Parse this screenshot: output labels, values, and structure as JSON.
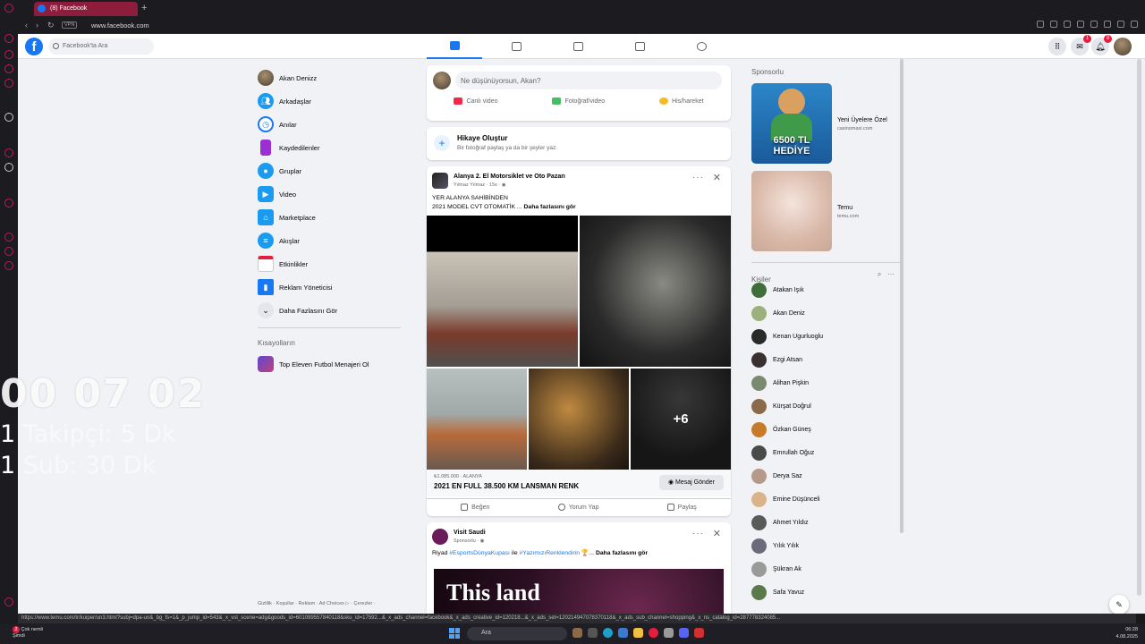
{
  "browser": {
    "tab_title": "(8) Facebook",
    "url": "www.facebook.com",
    "vpn_label": "VPN",
    "status_url": "https://www.temu.com/tr/kuiper/un3.html?subj=dpa-un&_bg_fs=1&_p_jump_id=543&_x_vst_scene=adg&goods_id=601099557840118&sku_id=17592...&_x_ads_channel=facebook&_x_ads_creative_id=120218...&_x_ads_set=120214947078370118&_x_ads_sub_channel=shopping&_x_ns_catalog_id=287778324085..."
  },
  "header": {
    "search_placeholder": "Facebook'ta Ara",
    "messenger_badge": "1",
    "notifications_badge": "8"
  },
  "left_nav": {
    "items": [
      {
        "label": "Akan Denizz",
        "icon": "user-avatar",
        "color": "#8a7a60"
      },
      {
        "label": "Arkadaşlar",
        "icon": "friends-icon",
        "color": "#1b9bf0"
      },
      {
        "label": "Anılar",
        "icon": "clock-icon",
        "color": "#1877f2"
      },
      {
        "label": "Kaydedilenler",
        "icon": "bookmark-icon",
        "color": "#9b2fd4"
      },
      {
        "label": "Gruplar",
        "icon": "groups-icon",
        "color": "#1b9bf0"
      },
      {
        "label": "Video",
        "icon": "video-icon",
        "color": "#1b9bf0"
      },
      {
        "label": "Marketplace",
        "icon": "marketplace-icon",
        "color": "#1b9bf0"
      },
      {
        "label": "Akışlar",
        "icon": "feeds-icon",
        "color": "#1b9bf0"
      },
      {
        "label": "Etkinlikler",
        "icon": "calendar-icon",
        "color": "#e41e3f"
      },
      {
        "label": "Reklam Yöneticisi",
        "icon": "chart-icon",
        "color": "#1877f2"
      },
      {
        "label": "Daha Fazlasını Gör",
        "icon": "chevron-down-icon",
        "color": "#d8dadf"
      }
    ],
    "shortcuts_heading": "Kısayolların",
    "shortcuts": [
      {
        "label": "Top Eleven Futbol Menajeri Ol",
        "icon": "game-icon"
      }
    ],
    "footer": "Gizlilik · Koşullar · Reklam · Ad Choices ▷ · Çerezler ·"
  },
  "composer": {
    "placeholder": "Ne düşünüyorsun, Akan?",
    "actions": [
      {
        "label": "Canlı video",
        "color": "#f02849"
      },
      {
        "label": "Fotoğraf/video",
        "color": "#45bd62"
      },
      {
        "label": "His/hareket",
        "color": "#f7b928"
      }
    ]
  },
  "story": {
    "title": "Hikaye Oluştur",
    "subtitle": "Bir fotoğraf paylaş ya da bir şeyler yaz."
  },
  "post1": {
    "group": "Alanya 2. El Motorsiklet ve Oto Pazarı",
    "author_meta": "Yılmaz Yılmaz · 15s · ◉",
    "line1": "YER ALANYA SAHİBİNDEN",
    "line2": "2021 MODEL CVT OTOMATİK ...",
    "see_more": "Daha fazlasını gör",
    "extra_photos": "+6",
    "price": "₺1.085.000 · ALANYA",
    "listing_title": "2021 EN FULL 38.500 KM LANSMAN RENK",
    "message_button": "Mesaj Gönder",
    "like": "Beğen",
    "comment": "Yorum Yap",
    "share": "Paylaş"
  },
  "post2": {
    "name": "Visit Saudi",
    "meta": "Sponsorlu · ◉",
    "text_prefix": "Riyad",
    "hashtag1": "#EsportsDünyaKupası",
    "text_mid": "ile",
    "hashtag2": "#YazımızıRenklendirin",
    "text_suffix": "🏆...",
    "see_more": "Daha fazlasını gör",
    "banner_text": "This land"
  },
  "right_rail": {
    "sponsored_heading": "Sponsorlu",
    "ads": [
      {
        "title": "Yeni Üyelere Özel",
        "site": "casinomaxi.com",
        "image_text": "6500 TL HEDİYE"
      },
      {
        "title": "Temu",
        "site": "temu.com"
      }
    ],
    "contacts_heading": "Kişiler",
    "contacts": [
      {
        "name": "Atakan Işık",
        "color": "#3f6e3a"
      },
      {
        "name": "Akan Deniz",
        "color": "#9bb07a"
      },
      {
        "name": "Kenan Ugurluoglu",
        "color": "#2a2a2a"
      },
      {
        "name": "Ezgi Atsan",
        "color": "#3a3030"
      },
      {
        "name": "Alihan Pişkin",
        "color": "#7a8a70"
      },
      {
        "name": "Kürşat Doğrul",
        "color": "#8a6a4a"
      },
      {
        "name": "Özkan Güneş",
        "color": "#c77a2a"
      },
      {
        "name": "Emrullah Oğuz",
        "color": "#4a4a4a"
      },
      {
        "name": "Derya Saz",
        "color": "#b59a8a"
      },
      {
        "name": "Emine Düşünceli",
        "color": "#d9b48a"
      },
      {
        "name": "Ahmet Yıldız",
        "color": "#5a5a5a"
      },
      {
        "name": "Yılık Yılık",
        "color": "#6a6a7a"
      },
      {
        "name": "Şükran Ak",
        "color": "#9a9a9a"
      },
      {
        "name": "Safa Yavuz",
        "color": "#5a7a4a"
      }
    ]
  },
  "overlay": {
    "timer": "00 07 02",
    "line1_num": "1",
    "line1_text": "Takipçi: 5 Dk",
    "line2_num": "1",
    "line2_text": "Sub: 30 Dk"
  },
  "taskbar": {
    "weather_badge": "2",
    "weather_line1": "Çok nemli",
    "weather_line2": "Şimdi",
    "search_placeholder": "Ara",
    "time": "06:28",
    "date": "4.08.2025"
  }
}
